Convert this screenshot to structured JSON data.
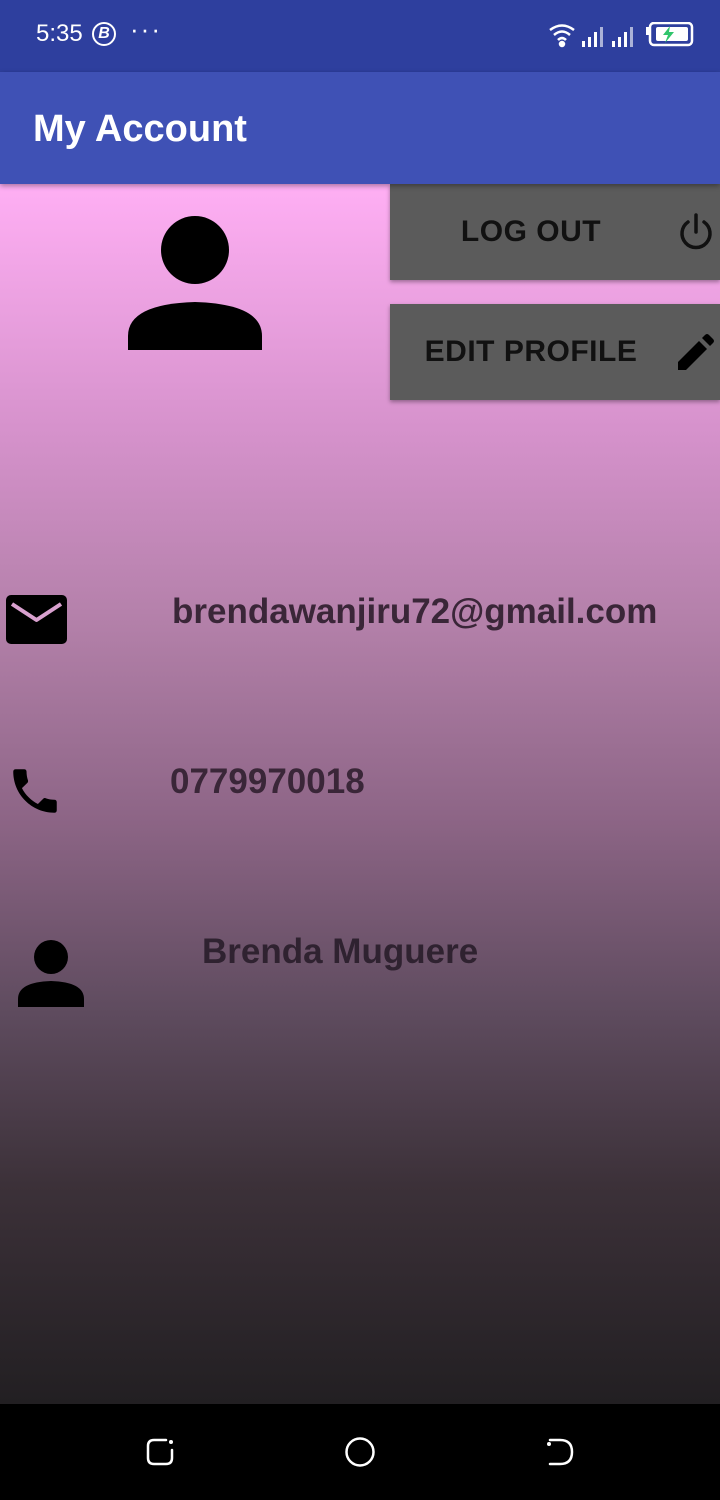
{
  "status_bar": {
    "time": "5:35",
    "badge_letter": "B",
    "dots": "···",
    "icons": [
      "wifi-icon",
      "signal-icon",
      "signal-icon",
      "battery-charging-icon"
    ]
  },
  "app_bar": {
    "title": "My Account",
    "color": "#3f51b5"
  },
  "actions": {
    "logout_label": "LOG OUT",
    "logout_icon": "power-icon",
    "edit_label": "EDIT PROFILE",
    "edit_icon": "pencil-icon"
  },
  "profile": {
    "avatar_icon": "person-icon",
    "email": "brendawanjiru72@gmail.com",
    "email_icon": "mail-icon",
    "phone": "0779970018",
    "phone_icon": "phone-icon",
    "name": "Brenda Muguere",
    "name_icon": "person-icon"
  },
  "nav_bar": {
    "buttons": [
      "recents-icon",
      "home-icon",
      "back-icon"
    ]
  }
}
